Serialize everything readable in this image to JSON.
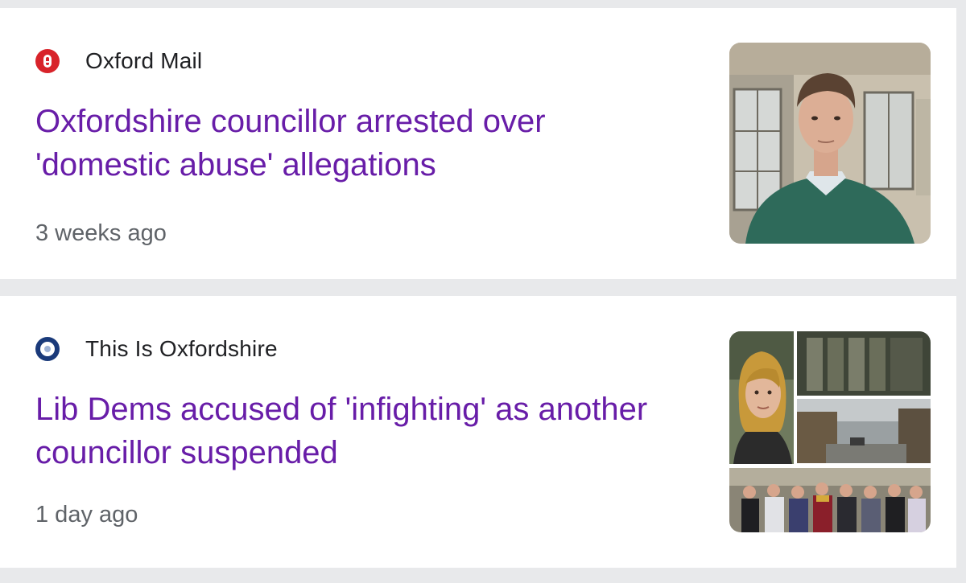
{
  "articles": [
    {
      "source": "Oxford Mail",
      "source_icon": "oxford-mail-logo",
      "headline": "Oxfordshire councillor arrested over 'domestic abuse' allegations",
      "time": "3 weeks ago"
    },
    {
      "source": "This Is Oxfordshire",
      "source_icon": "this-is-oxfordshire-logo",
      "headline": "Lib Dems accused of 'infighting' as another councillor suspended",
      "time": "1 day ago"
    }
  ],
  "colors": {
    "headline": "#681da8",
    "source": "#202124",
    "time": "#5f6368",
    "background": "#e8e9eb"
  }
}
